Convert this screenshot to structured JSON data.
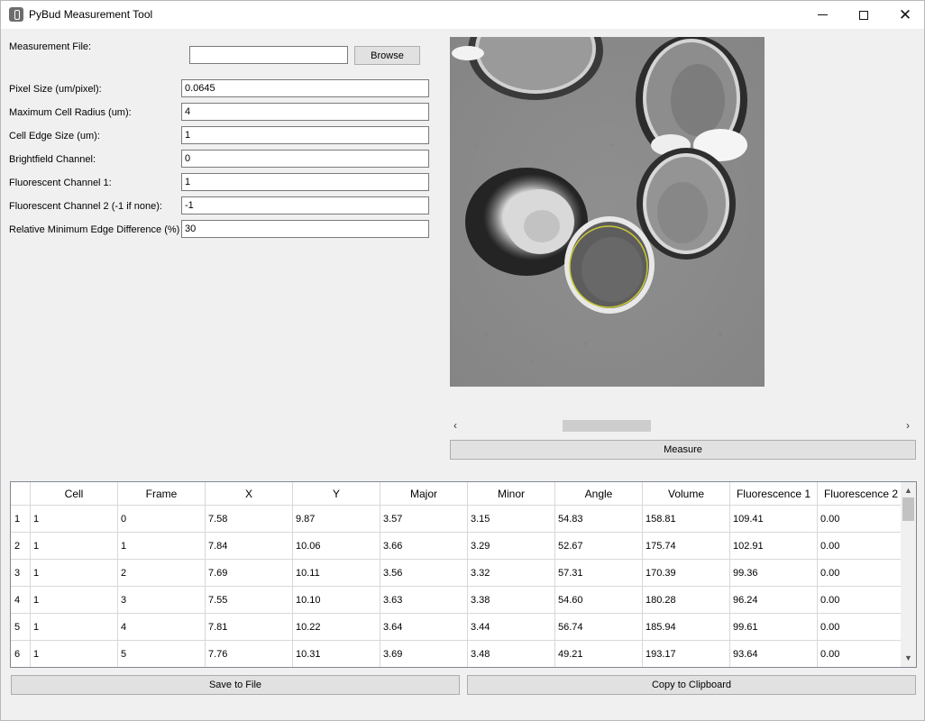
{
  "window": {
    "title": "PyBud Measurement Tool",
    "controls": {
      "minimize": "minimize",
      "maximize": "maximize",
      "close": "✕"
    }
  },
  "form": {
    "measurement_file_label": "Measurement File:",
    "measurement_file_value": "",
    "browse_label": "Browse",
    "fields": [
      {
        "label": "Pixel Size (um/pixel):",
        "value": "0.0645"
      },
      {
        "label": "Maximum Cell Radius (um):",
        "value": "4"
      },
      {
        "label": "Cell Edge Size (um):",
        "value": "1"
      },
      {
        "label": "Brightfield Channel:",
        "value": "0"
      },
      {
        "label": "Fluorescent Channel 1:",
        "value": "1"
      },
      {
        "label": "Fluorescent Channel 2 (-1 if none):",
        "value": "-1"
      },
      {
        "label": "Relative Minimum Edge Difference (%)",
        "value": "30"
      }
    ]
  },
  "image_scroll": {
    "left_arrow": "‹",
    "right_arrow": "›"
  },
  "measure_label": "Measure",
  "table": {
    "columns": [
      "Cell",
      "Frame",
      "X",
      "Y",
      "Major",
      "Minor",
      "Angle",
      "Volume",
      "Fluorescence 1",
      "Fluorescence 2"
    ],
    "rows": [
      {
        "index": "1",
        "cells": [
          "1",
          "0",
          "7.58",
          "9.87",
          "3.57",
          "3.15",
          "54.83",
          "158.81",
          "109.41",
          "0.00"
        ]
      },
      {
        "index": "2",
        "cells": [
          "1",
          "1",
          "7.84",
          "10.06",
          "3.66",
          "3.29",
          "52.67",
          "175.74",
          "102.91",
          "0.00"
        ]
      },
      {
        "index": "3",
        "cells": [
          "1",
          "2",
          "7.69",
          "10.11",
          "3.56",
          "3.32",
          "57.31",
          "170.39",
          "99.36",
          "0.00"
        ]
      },
      {
        "index": "4",
        "cells": [
          "1",
          "3",
          "7.55",
          "10.10",
          "3.63",
          "3.38",
          "54.60",
          "180.28",
          "96.24",
          "0.00"
        ]
      },
      {
        "index": "5",
        "cells": [
          "1",
          "4",
          "7.81",
          "10.22",
          "3.64",
          "3.44",
          "56.74",
          "185.94",
          "99.61",
          "0.00"
        ]
      },
      {
        "index": "6",
        "cells": [
          "1",
          "5",
          "7.76",
          "10.31",
          "3.69",
          "3.48",
          "49.21",
          "193.17",
          "93.64",
          "0.00"
        ]
      }
    ]
  },
  "buttons": {
    "save": "Save to File",
    "copy": "Copy to Clipboard"
  },
  "colors": {
    "ellipse_overlay": "#c8c832",
    "image_background": "#8a8a8a"
  }
}
